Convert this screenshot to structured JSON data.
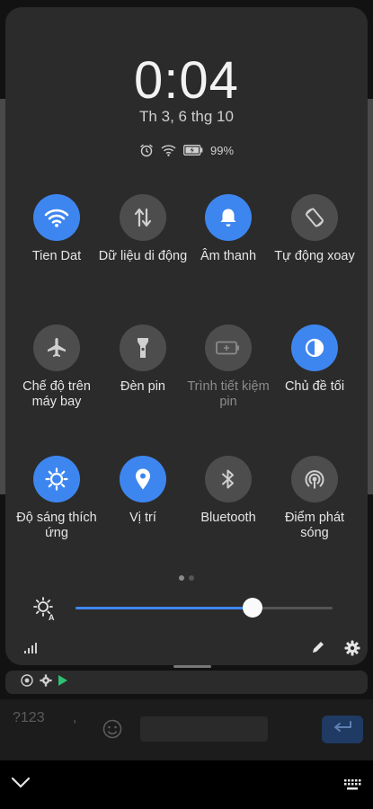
{
  "header": {
    "time": "0:04",
    "date": "Th 3, 6 thg 10",
    "battery_percent": "99%"
  },
  "tiles": [
    {
      "label": "Tien Dat",
      "state": "on",
      "icon": "wifi-icon"
    },
    {
      "label": "Dữ liệu di động",
      "state": "off",
      "icon": "mobile-data-icon"
    },
    {
      "label": "Âm thanh",
      "state": "on",
      "icon": "bell-icon"
    },
    {
      "label": "Tự động xoay",
      "state": "off",
      "icon": "auto-rotate-icon"
    },
    {
      "label": "Chế độ trên máy bay",
      "state": "off",
      "icon": "airplane-icon"
    },
    {
      "label": "Đèn pin",
      "state": "off",
      "icon": "flashlight-icon"
    },
    {
      "label": "Trình tiết kiệm pin",
      "state": "disabled",
      "icon": "battery-saver-icon"
    },
    {
      "label": "Chủ đề tối",
      "state": "on",
      "icon": "dark-theme-icon"
    },
    {
      "label": "Độ sáng thích ứng",
      "state": "on",
      "icon": "adaptive-brightness-icon"
    },
    {
      "label": "Vị trí",
      "state": "on",
      "icon": "location-icon"
    },
    {
      "label": "Bluetooth",
      "state": "off",
      "icon": "bluetooth-icon"
    },
    {
      "label": "Điểm phát sóng",
      "state": "off",
      "icon": "hotspot-icon"
    }
  ],
  "brightness": {
    "level": 0.69,
    "icon": "brightness-auto-icon"
  },
  "pager": {
    "pages": 2,
    "current": 1
  },
  "keyboard": {
    "symbols_key": "?123",
    "comma_key": ","
  },
  "colors": {
    "accent": "#3e86ef",
    "tile_off": "#4d4d4d",
    "panel": "#2b2b2b"
  }
}
